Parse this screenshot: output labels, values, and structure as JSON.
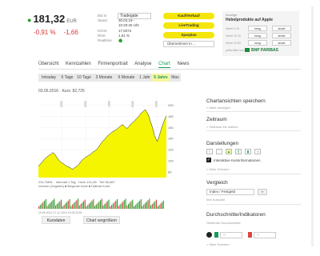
{
  "quote": {
    "price": "181,32",
    "currency": "EUR",
    "change_pct": "-0,91 %",
    "change_abs": "-1,66"
  },
  "info": {
    "rows": [
      {
        "label": "Bid in",
        "value": ""
      },
      {
        "label": "Stand",
        "value": "30.04.19 -"
      },
      {
        "label": "",
        "value": "10:20:25 Uhr"
      },
      {
        "label": "KGVe",
        "value": "17,8372"
      },
      {
        "label": "DIVe",
        "value": "1,51 %"
      },
      {
        "label": "Realtime",
        "value": ""
      }
    ],
    "venue": "Tradegate"
  },
  "actions": {
    "buy": "Kauf/Verkauf",
    "live": "LiveTrading",
    "savings": "Sparplan",
    "overview": "Übernehmen in ..."
  },
  "sidebox": {
    "label": "Anzeige",
    "title": "Hebelprodukte auf Apple",
    "rows": [
      {
        "label": "Hebel 5-10",
        "long": "long",
        "short": "short"
      },
      {
        "label": "Hebel 10-20",
        "long": "long",
        "short": "short"
      },
      {
        "label": "Hebel 20-50",
        "long": "long",
        "short": "short"
      }
    ],
    "sponsor_label": "präsentiert von",
    "sponsor": "BNP PARIBAS"
  },
  "tabs": [
    "Übersicht",
    "Kennzahlen",
    "Firmenportrait",
    "Analyse",
    "Chart",
    "News"
  ],
  "active_tab": "Chart",
  "periods": [
    "Intraday",
    "5 Tage",
    "10 Tage",
    "3 Monate",
    "6 Monate",
    "1 Jahr",
    "5 Jahre",
    "Max"
  ],
  "active_period": "5 Jahre",
  "chart_info": "03.05.2016 · Kurs: 82,725",
  "chart_footer": {
    "low": "232,7MHL",
    "interval": "Intervall 1 Tag",
    "hoch": "Hoch 101,85",
    "tief": "Tief 60,667"
  },
  "volume_legend": "Volumen (Vorgaben)   ■ Steigende Kurse   ■ Fallende Kurse",
  "volume_axis": "19.05.2014    17.11.2014    19.05.2015",
  "buttons": {
    "data": "Kursdaten",
    "compare": "Chart vergrößern"
  },
  "right": {
    "saved": {
      "title": "Chartansichten speichern",
      "sub": "> Mehr anzeigen"
    },
    "range": {
      "title": "Zeitraum",
      "sub": "> Zeitraum frei wählen"
    },
    "display": {
      "title": "Darstellungen",
      "checkbox": "Interaktive Kursinformationen",
      "sub": "> Mehr Kriterien"
    },
    "compare": {
      "title": "Vergleich",
      "select": "Index / Festgeld",
      "sub": "Ihre Auswahl"
    },
    "indicators": {
      "title": "Durchschnitte/Indikatoren",
      "sub": "Gleitende Durchschnitte",
      "sel1": "--",
      "sel2": "--",
      "more": "> Mehr Kriterien"
    }
  },
  "chart_data": {
    "type": "area",
    "x_start": "2014",
    "x_ticks": [
      "2015",
      "2016",
      "2017",
      "2018",
      "2019"
    ],
    "y_ticks": [
      80,
      100,
      120,
      140,
      160,
      180,
      200
    ],
    "ylim": [
      70,
      215
    ],
    "color": "#f5f500",
    "values": [
      90,
      93,
      96,
      98,
      101,
      104,
      106,
      108,
      110,
      111,
      113,
      115,
      113,
      110,
      106,
      103,
      100,
      98,
      96,
      95,
      93,
      91,
      90,
      89,
      88,
      86,
      85,
      87,
      89,
      90,
      92,
      95,
      98,
      101,
      103,
      105,
      107,
      108,
      110,
      111,
      113,
      115,
      117,
      118,
      120,
      123,
      126,
      130,
      133,
      136,
      138,
      141,
      144,
      146,
      148,
      150,
      152,
      153,
      155,
      156,
      158,
      160,
      162,
      164,
      165,
      162,
      160,
      158,
      160,
      163,
      166,
      168,
      170,
      172,
      175,
      177,
      180,
      183,
      186,
      188,
      190,
      192,
      188,
      184,
      178,
      170,
      163,
      155,
      145,
      140,
      135,
      140,
      148,
      156,
      163,
      170,
      176,
      181
    ]
  }
}
